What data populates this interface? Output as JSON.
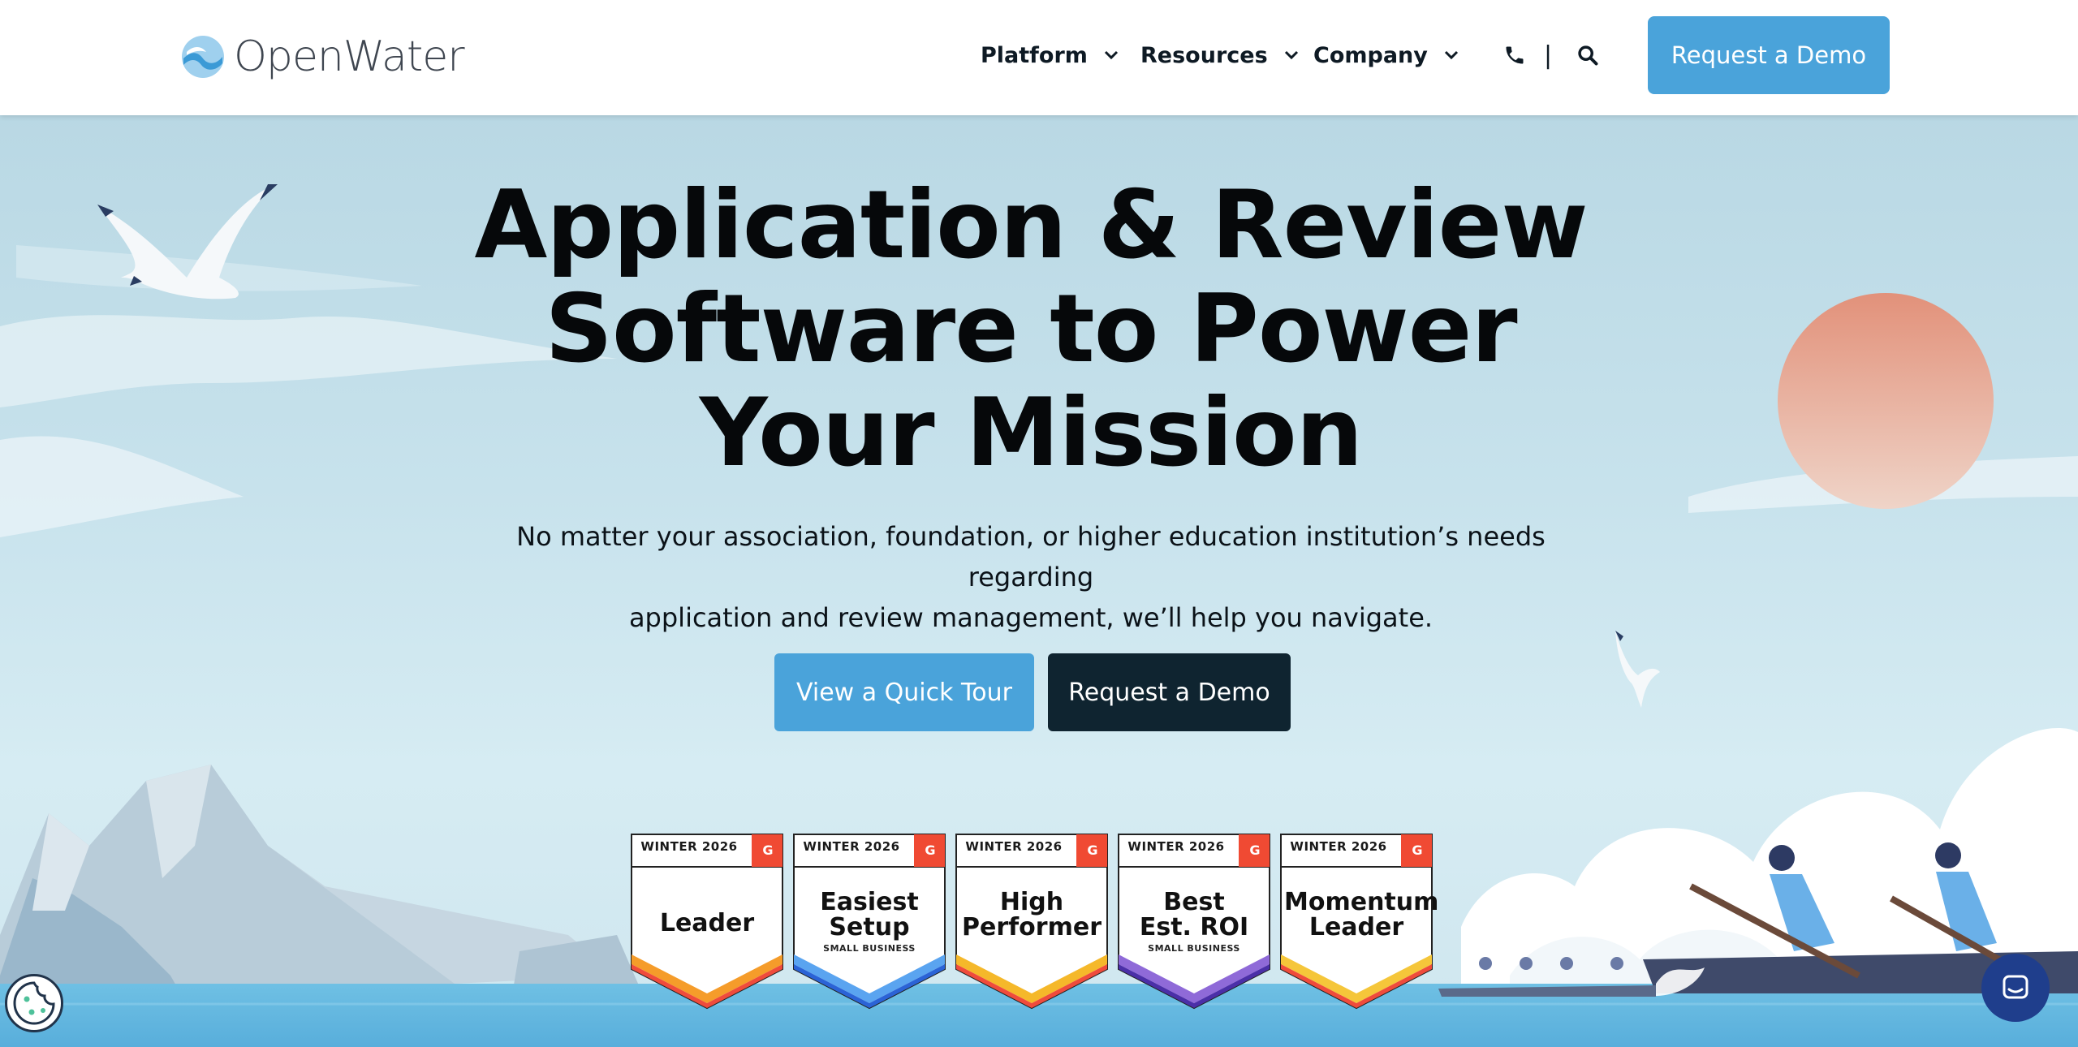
{
  "brand": {
    "name": "OpenWater",
    "accent": "#4aa3da",
    "dark": "#0f2430"
  },
  "nav": {
    "items": [
      {
        "label": "Platform",
        "icon": "chevron-down-icon"
      },
      {
        "label": "Resources",
        "icon": "chevron-down-icon"
      },
      {
        "label": "Company",
        "icon": "chevron-down-icon"
      }
    ],
    "divider": "|",
    "phone_icon": "phone-icon",
    "search_icon": "search-icon",
    "cta_label": "Request a Demo"
  },
  "hero": {
    "title_lines": [
      "Application & Review",
      "Software to Power",
      "Your Mission"
    ],
    "subtitle_lines": [
      "No matter your association, foundation, or higher education institution’s needs regarding",
      "application and review management, we’ll help you navigate."
    ],
    "primary_button": "View a Quick Tour",
    "secondary_button": "Request a Demo"
  },
  "badges": [
    {
      "season": "WINTER 2026",
      "lines": [
        "Leader"
      ],
      "sublabel": "",
      "stripe_colors": [
        "#f59c2a",
        "#ef4b3c"
      ]
    },
    {
      "season": "WINTER 2026",
      "lines": [
        "Easiest",
        "Setup"
      ],
      "sublabel": "SMALL BUSINESS",
      "stripe_colors": [
        "#5aa4f0",
        "#2b63d6"
      ]
    },
    {
      "season": "WINTER 2026",
      "lines": [
        "High",
        "Performer"
      ],
      "sublabel": "",
      "stripe_colors": [
        "#f5b82a",
        "#ef4b3c"
      ]
    },
    {
      "season": "WINTER 2026",
      "lines": [
        "Best",
        "Est. ROI"
      ],
      "sublabel": "SMALL BUSINESS",
      "stripe_colors": [
        "#8f6ad8",
        "#4b2fa8"
      ]
    },
    {
      "season": "WINTER 2026",
      "lines": [
        "Momentum",
        "Leader"
      ],
      "sublabel": "",
      "stripe_colors": [
        "#f5c63a",
        "#ef4b3c"
      ]
    }
  ],
  "badge_brand_mark": "G",
  "widgets": {
    "cookie_icon": "cookie-icon",
    "chat_icon": "chat-icon"
  }
}
